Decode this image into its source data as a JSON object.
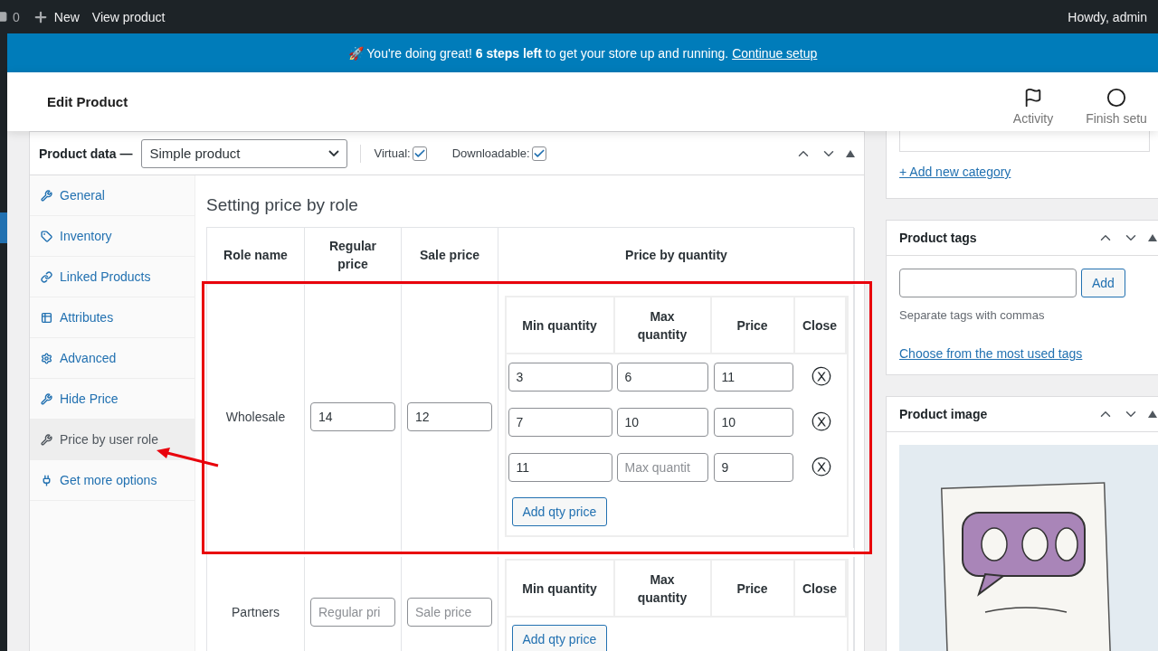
{
  "admin_bar": {
    "comments_count": "0",
    "new_label": "New",
    "view_label": "View product",
    "greeting": "Howdy, admin"
  },
  "notice": {
    "text": "🚀 You're doing great! **6 steps left** to get your store up and running.",
    "link": "Continue setup"
  },
  "header": {
    "title": "Edit Product",
    "actions": [
      {
        "label": "Activity",
        "kind": "flag"
      },
      {
        "label": "Finish setu",
        "kind": "circle"
      }
    ]
  },
  "product_data": {
    "label": "Product data —",
    "type": "Simple product",
    "options": [
      {
        "label": "Virtual:",
        "checked": true
      },
      {
        "label": "Downloadable:",
        "checked": true
      }
    ]
  },
  "tabs": [
    {
      "label": "General",
      "selected": false
    },
    {
      "label": "Inventory",
      "selected": false
    },
    {
      "label": "Linked Products",
      "selected": false
    },
    {
      "label": "Attributes",
      "selected": false
    },
    {
      "label": "Advanced",
      "selected": false
    },
    {
      "label": "Hide Price",
      "selected": false
    },
    {
      "label": "Price by user role",
      "selected": true
    },
    {
      "label": "Get more options",
      "selected": false
    }
  ],
  "section_title": "Setting price by role",
  "columns": [
    "Role name",
    "Regular price",
    "Sale price",
    "Price by quantity"
  ],
  "roles": [
    {
      "name": "Wholesale",
      "regular_price": {
        "value": "14"
      },
      "sale_price": {
        "value": "12"
      },
      "qty_columns": [
        "Min quantity",
        "Max quantity",
        "Price",
        "Close"
      ],
      "qty_rows": [
        {
          "min": {
            "value": "3"
          },
          "max": {
            "value": "6"
          },
          "price": {
            "value": "11"
          },
          "close": "ⓧ"
        },
        {
          "min": {
            "value": "7"
          },
          "max": {
            "value": "10"
          },
          "price": {
            "value": "10"
          },
          "close": "ⓧ"
        },
        {
          "min": {
            "value": "11"
          },
          "max": {
            "placeholder": "Max quantit"
          },
          "price": {
            "value": "9"
          },
          "close": "ⓧ"
        }
      ],
      "add_button": "Add qty price"
    },
    {
      "name": "Partners",
      "regular_price": {
        "placeholder": "Regular pri"
      },
      "sale_price": {
        "placeholder": "Sale price"
      },
      "qty_columns": [
        "Min quantity",
        "Max quantity",
        "Price",
        "Close"
      ],
      "add_button": "Add qty price"
    }
  ],
  "categories": {
    "add_link": "+ Add new category"
  },
  "tags": {
    "title": "Product tags",
    "add_button": "Add",
    "hint": "Separate tags with commas",
    "link": "Choose from the most used tags"
  },
  "image": {
    "title": "Product image",
    "kind": "picture"
  }
}
